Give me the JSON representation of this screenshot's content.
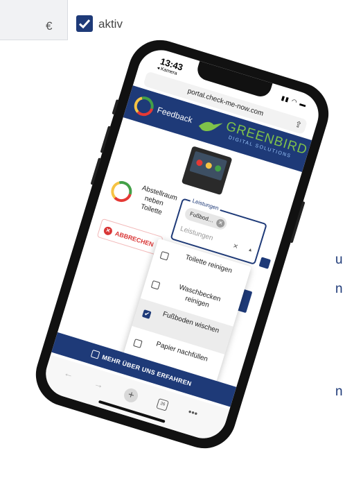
{
  "background": {
    "currency_symbol": "€",
    "checkbox_label": "aktiv",
    "checkbox_checked": true,
    "text_fragments": [
      "u",
      "n",
      "n"
    ]
  },
  "phone": {
    "status_bar": {
      "time": "13:43",
      "back_label": "◂ Kamera"
    },
    "browser": {
      "url": "portal.check-me-now.com",
      "share_icon": "share-icon"
    },
    "navbar": {
      "feedback_label": "Feedback",
      "brand_name": "GREENBIRD",
      "brand_subtitle": "DIGITAL SOLUTIONS",
      "color": "#1e3a78"
    },
    "location": {
      "lines": [
        "Abstellraum",
        "neben",
        "Toilette"
      ]
    },
    "cancel_button": {
      "label": "ABBRECHEN",
      "color": "#d93636"
    },
    "services_field": {
      "legend": "Leistungen",
      "chip_label": "Fußbod…",
      "placeholder": "Leistungen",
      "clear_glyph": "×",
      "caret_glyph": "▲"
    },
    "dropdown_options": [
      {
        "label": "Toilette reinigen",
        "checked": false
      },
      {
        "label": "Waschbecken reinigen",
        "checked": false
      },
      {
        "label": "Fußboden wischen",
        "checked": true
      },
      {
        "label": "Papier nachfüllen",
        "checked": false
      }
    ],
    "cta_button": {
      "label": "MEHR ÜBER UNS ERFAHREN"
    },
    "toolbar": {
      "back_glyph": "←",
      "forward_glyph": "→",
      "new_tab_glyph": "+",
      "tabs_count": "26",
      "more_glyph": "•••"
    }
  }
}
